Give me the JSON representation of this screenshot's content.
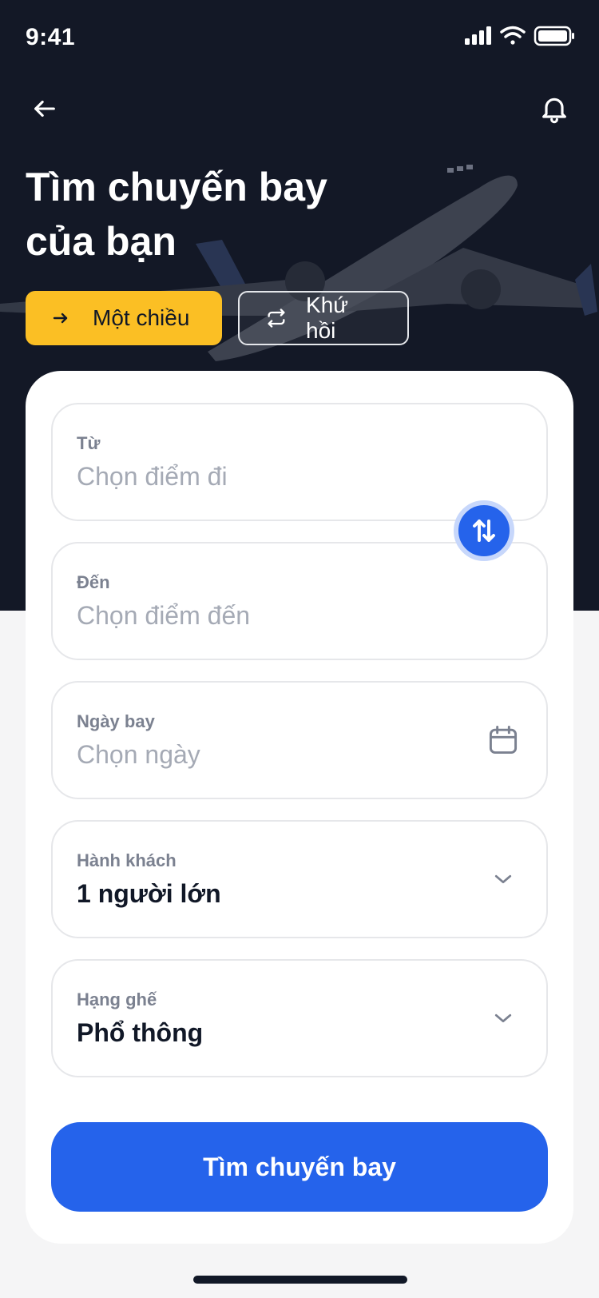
{
  "status_bar": {
    "time": "9:41"
  },
  "header": {
    "title_line1": "Tìm chuyến bay",
    "title_line2": "của bạn"
  },
  "trip_type": {
    "one_way": "Một chiều",
    "round_trip": "Khứ hồi",
    "selected": "one_way"
  },
  "form": {
    "from": {
      "label": "Từ",
      "placeholder": "Chọn điểm đi"
    },
    "to": {
      "label": "Đến",
      "placeholder": "Chọn điểm đến"
    },
    "date": {
      "label": "Ngày bay",
      "placeholder": "Chọn ngày"
    },
    "passengers": {
      "label": "Hành khách",
      "value": "1 người lớn"
    },
    "cabin_class": {
      "label": "Hạng ghế",
      "value": "Phổ thông"
    },
    "submit_label": "Tìm chuyến bay"
  },
  "icons": {
    "back": "arrow-left-icon",
    "notifications": "bell-icon",
    "one_way": "arrow-right-icon",
    "round_trip": "repeat-icon",
    "swap": "swap-vertical-icon",
    "calendar": "calendar-icon",
    "dropdown": "chevron-down-icon"
  },
  "colors": {
    "hero_bg": "#131826",
    "accent_yellow": "#fbbf24",
    "primary_blue": "#2563eb"
  }
}
